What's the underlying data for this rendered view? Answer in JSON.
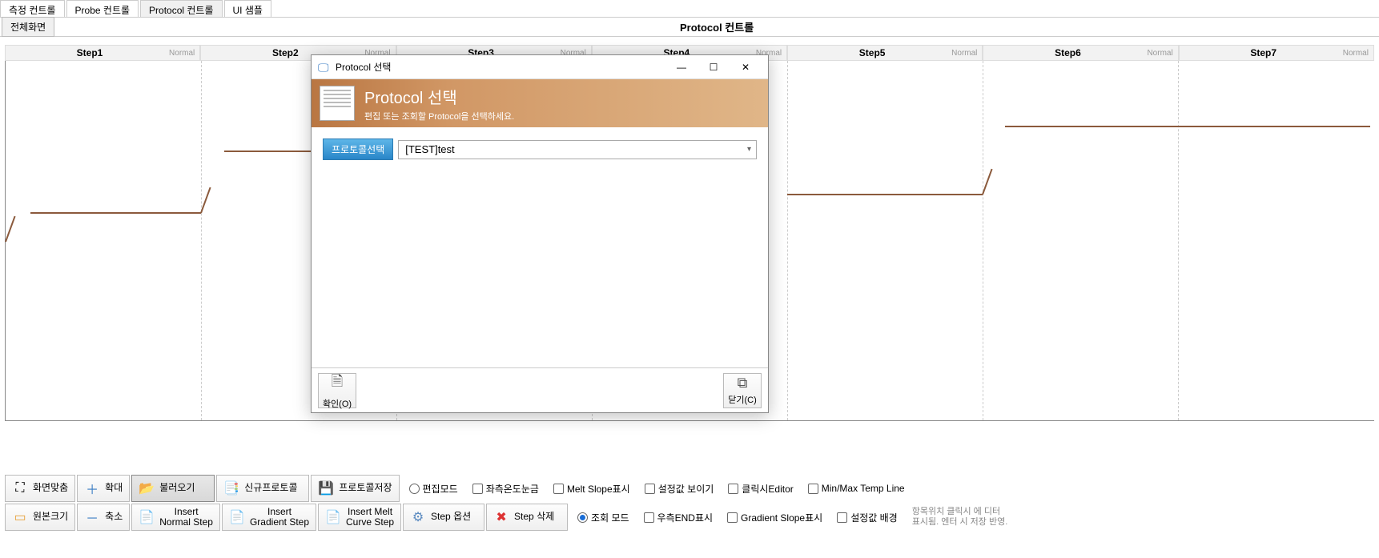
{
  "tabs": [
    "측정 컨트롤",
    "Probe 컨트롤",
    "Protocol 컨트롤",
    "UI 샘플"
  ],
  "active_tab": 2,
  "subbar": {
    "fullscreen": "전체화면",
    "title": "Protocol 컨트롤"
  },
  "steps": [
    {
      "name": "Step1",
      "type": "Normal"
    },
    {
      "name": "Step2",
      "type": "Normal"
    },
    {
      "name": "Step3",
      "type": "Normal"
    },
    {
      "name": "Step4",
      "type": "Normal"
    },
    {
      "name": "Step5",
      "type": "Normal"
    },
    {
      "name": "Step6",
      "type": "Normal"
    },
    {
      "name": "Step7",
      "type": "Normal"
    }
  ],
  "toolbar": {
    "row1": {
      "fit": "화면맞춤",
      "zoom_in": "확대",
      "load": "불러오기",
      "new_protocol": "신규프로토콜",
      "save": "프로토콜저장"
    },
    "row2": {
      "orig": "원본크기",
      "zoom_out": "축소",
      "ins_normal": "Insert\nNormal Step",
      "ins_gradient": "Insert\nGradient Step",
      "ins_melt": "Insert Melt\nCurve Step",
      "step_opt": "Step 옵션",
      "step_del": "Step 삭제"
    },
    "opts": {
      "edit_mode": "편집모드",
      "left_temp_scale": "좌측온도눈금",
      "melt_slope": "Melt Slope표시",
      "show_set": "설정값 보이기",
      "click_editor": "클릭시Editor",
      "minmax": "Min/Max Temp Line",
      "view_mode": "조회 모드",
      "right_end": "우측END표시",
      "gradient_slope": "Gradient Slope표시",
      "set_bg": "설정값 배경",
      "hint": "항목위치 클릭시 에\n디터 표시됨. 엔터\n시 저장 반영."
    }
  },
  "modal": {
    "window_title": "Protocol 선택",
    "header_title": "Protocol 선택",
    "header_sub": "편집 또는 조회할 Protocol을 선택하세요.",
    "select_label": "프로토콜선택",
    "select_value": "[TEST]test",
    "ok": "확인(O)",
    "close": "닫기(C)"
  }
}
